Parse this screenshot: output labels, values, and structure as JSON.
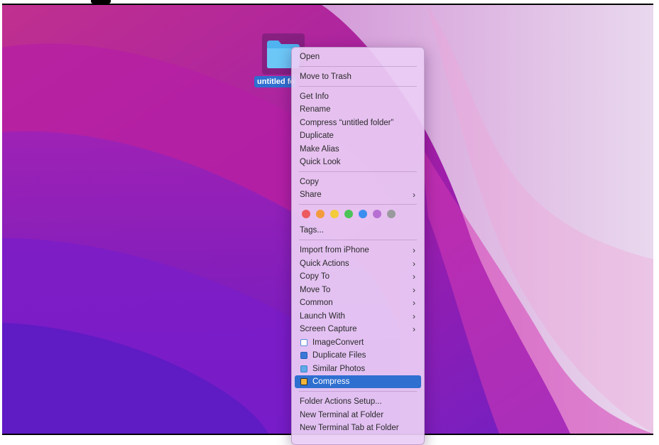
{
  "desktop": {
    "folder_label": "untitled fo"
  },
  "context_menu": {
    "items": [
      {
        "label": "Open"
      },
      {
        "label": "Move to Trash"
      },
      {
        "label": "Get Info"
      },
      {
        "label": "Rename"
      },
      {
        "label": "Compress “untitled folder”"
      },
      {
        "label": "Duplicate"
      },
      {
        "label": "Make Alias"
      },
      {
        "label": "Quick Look"
      },
      {
        "label": "Copy"
      },
      {
        "label": "Share"
      },
      {
        "label": "Tags..."
      },
      {
        "label": "Import from iPhone"
      },
      {
        "label": "Quick Actions"
      },
      {
        "label": "Copy To"
      },
      {
        "label": "Move To"
      },
      {
        "label": "Common"
      },
      {
        "label": "Launch With"
      },
      {
        "label": "Screen Capture"
      },
      {
        "label": "ImageConvert"
      },
      {
        "label": "Duplicate Files"
      },
      {
        "label": "Similar Photos"
      },
      {
        "label": "Compress"
      },
      {
        "label": "Folder Actions Setup..."
      },
      {
        "label": "New Terminal at Folder"
      },
      {
        "label": "New Terminal Tab at Folder"
      }
    ],
    "submenu_chevron": "›",
    "tag_colors": [
      "#ec5a5f",
      "#f39b3d",
      "#f4cb3a",
      "#4cc356",
      "#3b8ef0",
      "#b76fd4",
      "#9a9a9e"
    ],
    "highlight_color": "#2f6fd0"
  }
}
